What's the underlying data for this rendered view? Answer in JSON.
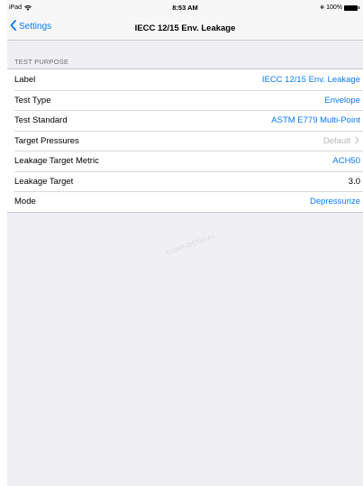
{
  "status_bar": {
    "device": "iPad",
    "time": "8:53 AM",
    "battery": "100%",
    "bluetooth": "✻"
  },
  "nav": {
    "back_label": "Settings",
    "title": "IECC 12/15 Env. Leakage"
  },
  "section": {
    "header": "TEST PURPOSE"
  },
  "rows": [
    {
      "label": "Label",
      "value": "IECC 12/15 Env. Leakage"
    },
    {
      "label": "Test Type",
      "value": "Envelope"
    },
    {
      "label": "Test Standard",
      "value": "ASTM E779 Multi-Point"
    },
    {
      "label": "Target Pressures",
      "value": "Default"
    },
    {
      "label": "Leakage Target Metric",
      "value": "ACH50"
    },
    {
      "label": "Leakage Target",
      "value": "3.0"
    },
    {
      "label": "Mode",
      "value": "Depressurize"
    }
  ],
  "watermark": "CONFIDENTIAL",
  "colors": {
    "accent": "#0a7aff",
    "background": "#efeff4",
    "separator": "#c8c7cc",
    "muted": "#b7b7bc"
  }
}
